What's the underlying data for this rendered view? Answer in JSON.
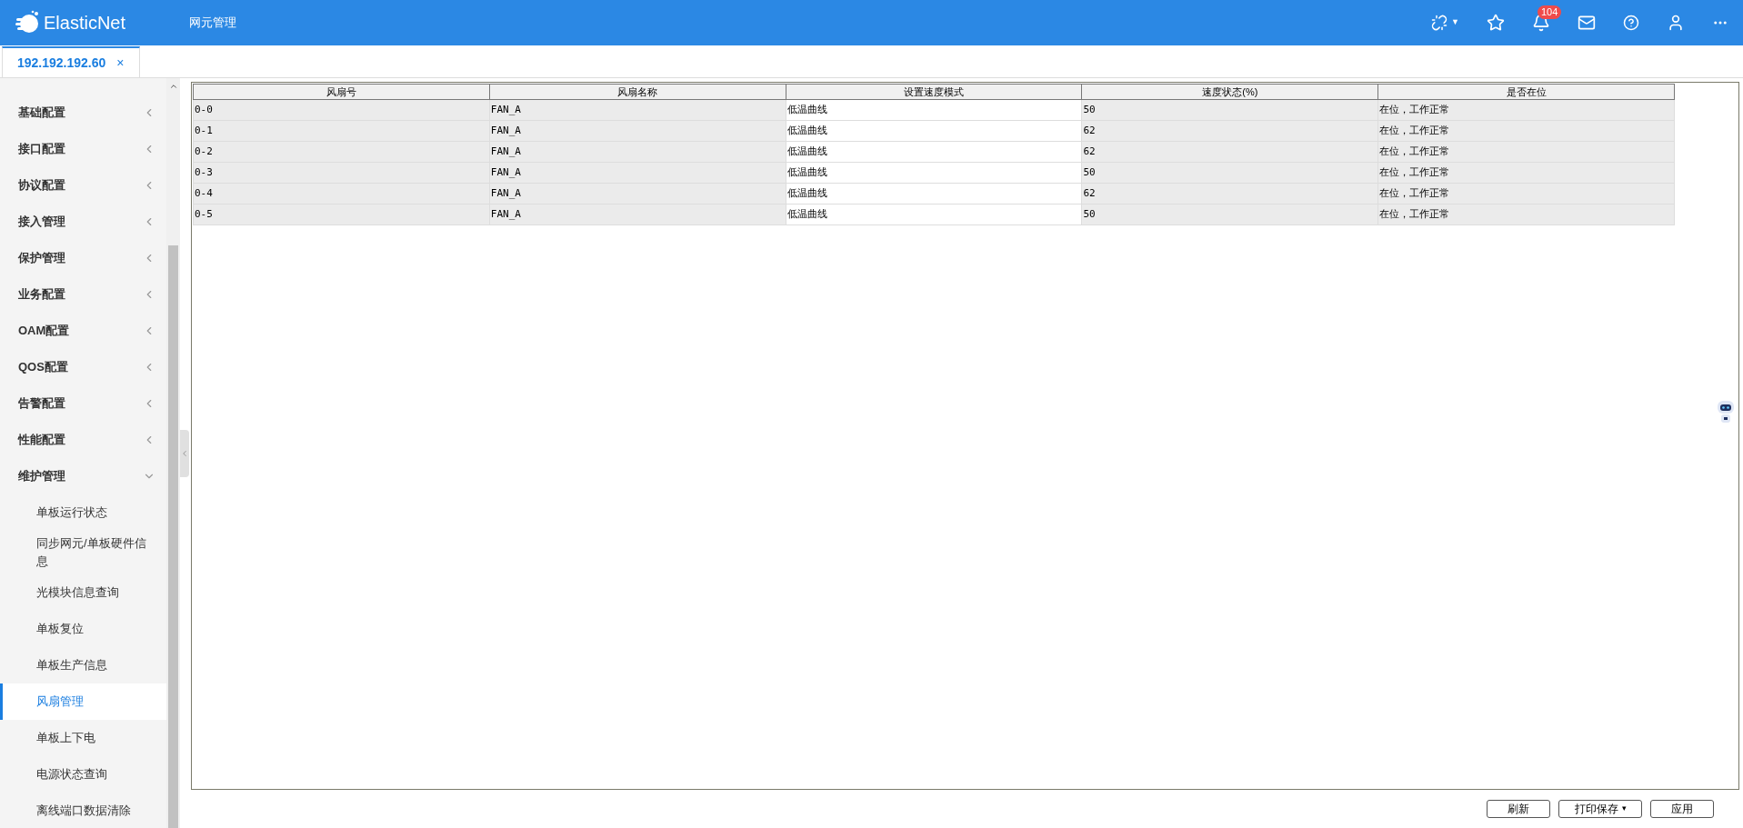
{
  "header": {
    "logo": "ElasticNet",
    "title": "网元管理",
    "notification_count": "104",
    "link_caret": "▼"
  },
  "tabs": [
    {
      "label": "192.192.192.60",
      "selected": true,
      "close": "×"
    }
  ],
  "sidebar": {
    "items": [
      {
        "label": "基础配置",
        "expanded": false
      },
      {
        "label": "接口配置",
        "expanded": false
      },
      {
        "label": "协议配置",
        "expanded": false
      },
      {
        "label": "接入管理",
        "expanded": false
      },
      {
        "label": "保护管理",
        "expanded": false
      },
      {
        "label": "业务配置",
        "expanded": false
      },
      {
        "label": "OAM配置",
        "expanded": false
      },
      {
        "label": "QOS配置",
        "expanded": false
      },
      {
        "label": "告警配置",
        "expanded": false
      },
      {
        "label": "性能配置",
        "expanded": false
      },
      {
        "label": "维护管理",
        "expanded": true,
        "children": [
          {
            "label": "单板运行状态",
            "selected": false
          },
          {
            "label": "同步网元/单板硬件信息",
            "selected": false
          },
          {
            "label": "光模块信息查询",
            "selected": false
          },
          {
            "label": "单板复位",
            "selected": false
          },
          {
            "label": "单板生产信息",
            "selected": false
          },
          {
            "label": "风扇管理",
            "selected": true
          },
          {
            "label": "单板上下电",
            "selected": false
          },
          {
            "label": "电源状态查询",
            "selected": false
          },
          {
            "label": "离线端口数据清除",
            "selected": false
          }
        ]
      }
    ]
  },
  "table": {
    "columns": [
      {
        "label": "风扇号",
        "editable": false
      },
      {
        "label": "风扇名称",
        "editable": false
      },
      {
        "label": "设置速度模式",
        "editable": true
      },
      {
        "label": "速度状态(%)",
        "editable": false
      },
      {
        "label": "是否在位",
        "editable": false
      }
    ],
    "rows": [
      [
        "0-0",
        "FAN_A",
        "低温曲线",
        "50",
        "在位，工作正常"
      ],
      [
        "0-1",
        "FAN_A",
        "低温曲线",
        "62",
        "在位，工作正常"
      ],
      [
        "0-2",
        "FAN_A",
        "低温曲线",
        "62",
        "在位，工作正常"
      ],
      [
        "0-3",
        "FAN_A",
        "低温曲线",
        "50",
        "在位，工作正常"
      ],
      [
        "0-4",
        "FAN_A",
        "低温曲线",
        "62",
        "在位，工作正常"
      ],
      [
        "0-5",
        "FAN_A",
        "低温曲线",
        "50",
        "在位，工作正常"
      ]
    ]
  },
  "buttons": [
    {
      "label": "刷新",
      "kind": "plain"
    },
    {
      "label": "打印保存",
      "kind": "menu",
      "caret": "▾"
    },
    {
      "label": "应用",
      "kind": "plain"
    }
  ]
}
